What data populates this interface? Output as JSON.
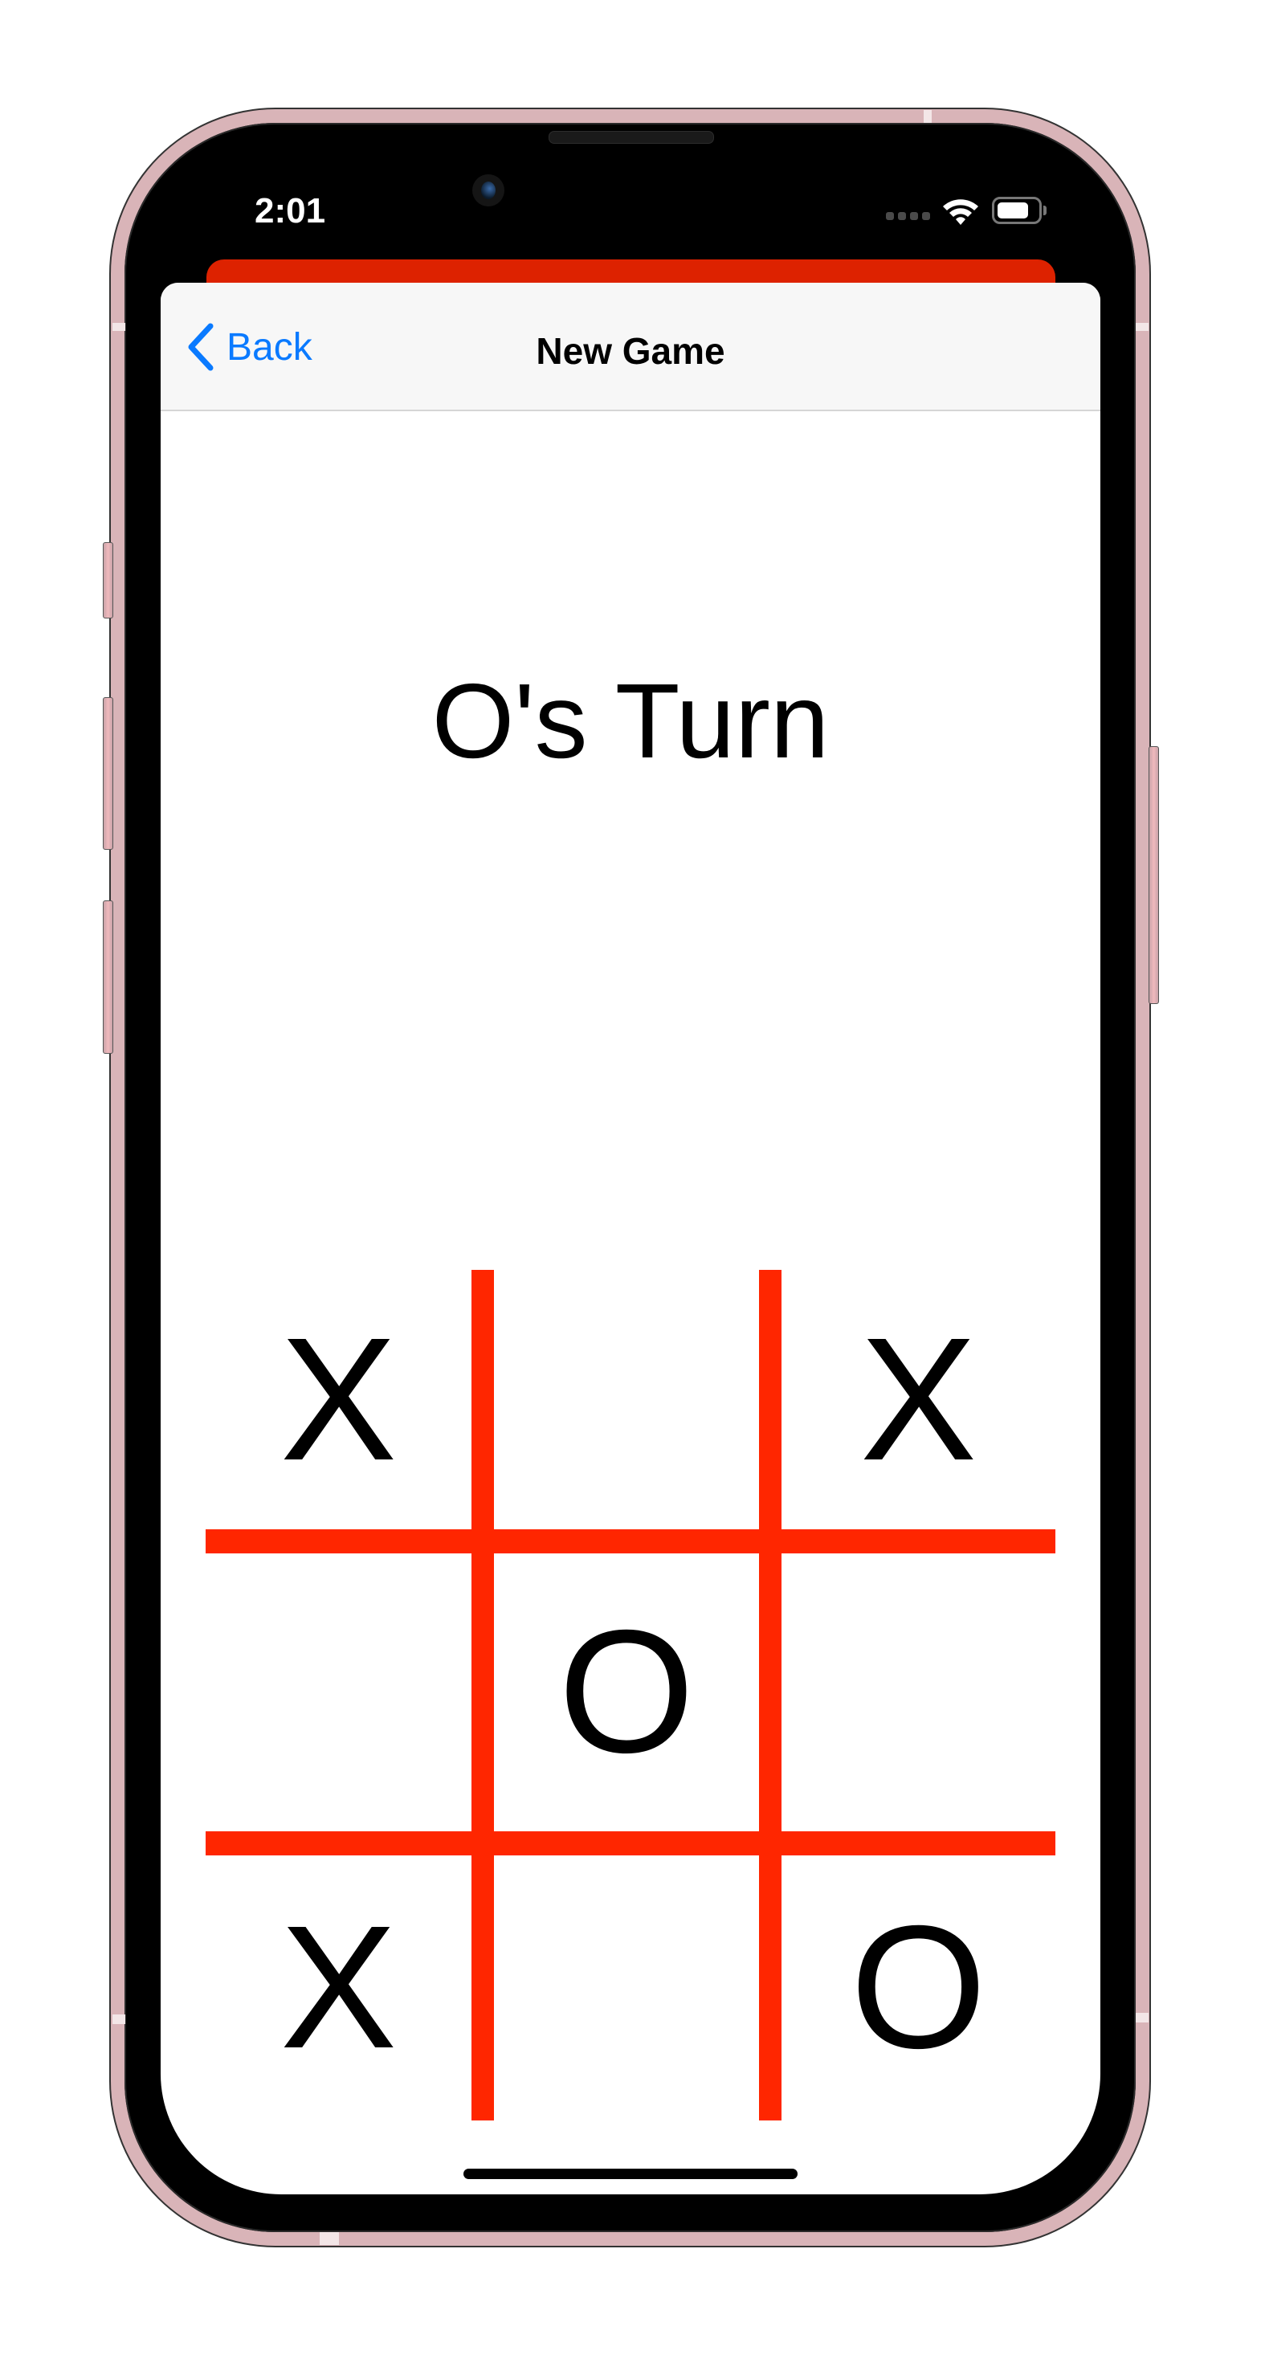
{
  "status_bar": {
    "time": "2:01",
    "signal_icon": "signal-dots-icon",
    "wifi_icon": "wifi-icon",
    "battery_icon": "battery-icon",
    "battery_level": 0.8
  },
  "colors": {
    "accent": "#0A7AFF",
    "grid": "#FF2600",
    "card_behind": "#DD2200",
    "navbar_bg": "#F7F7F7"
  },
  "navbar": {
    "back_icon": "chevron-left-icon",
    "back_label": "Back",
    "title": "New Game"
  },
  "game": {
    "turn_label": "O's Turn",
    "board": [
      [
        "X",
        "",
        "X"
      ],
      [
        "",
        "O",
        ""
      ],
      [
        "X",
        "",
        "O"
      ]
    ]
  }
}
